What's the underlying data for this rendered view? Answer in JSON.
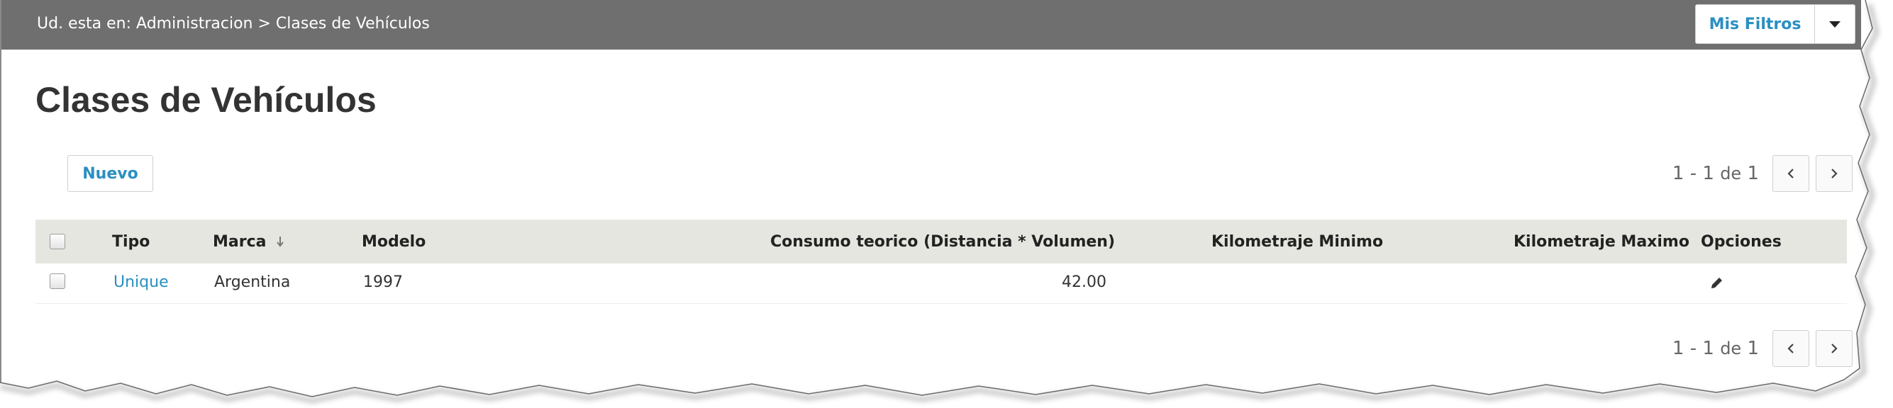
{
  "breadcrumb": "Ud. esta en: Administracion > Clases de Vehículos",
  "filters": {
    "label": "Mis Filtros",
    "dropdown_icon": "chevron-down-icon"
  },
  "page": {
    "title": "Clases de Vehículos"
  },
  "toolbar": {
    "new_label": "Nuevo"
  },
  "pagination": {
    "range": "1 - 1",
    "of_label": "de",
    "total": "1",
    "prev_icon": "chevron-left-icon",
    "next_icon": "chevron-right-icon"
  },
  "table": {
    "headers": {
      "tipo": "Tipo",
      "marca": "Marca",
      "modelo": "Modelo",
      "consumo": "Consumo teorico (Distancia * Volumen)",
      "km_min": "Kilometraje Minimo",
      "km_max": "Kilometraje Maximo",
      "opciones": "Opciones"
    },
    "sort": {
      "column": "Marca",
      "direction": "down",
      "icon": "arrow-down-icon"
    },
    "rows": [
      {
        "tipo": "Unique",
        "marca": "Argentina",
        "modelo": "1997",
        "consumo": "42.00",
        "km_min": "",
        "km_max": "",
        "edit_icon": "pencil-icon"
      }
    ]
  },
  "colors": {
    "topbar": "#6f6f6f",
    "link": "#2a8fc1",
    "table_header": "#e6e6e0"
  }
}
